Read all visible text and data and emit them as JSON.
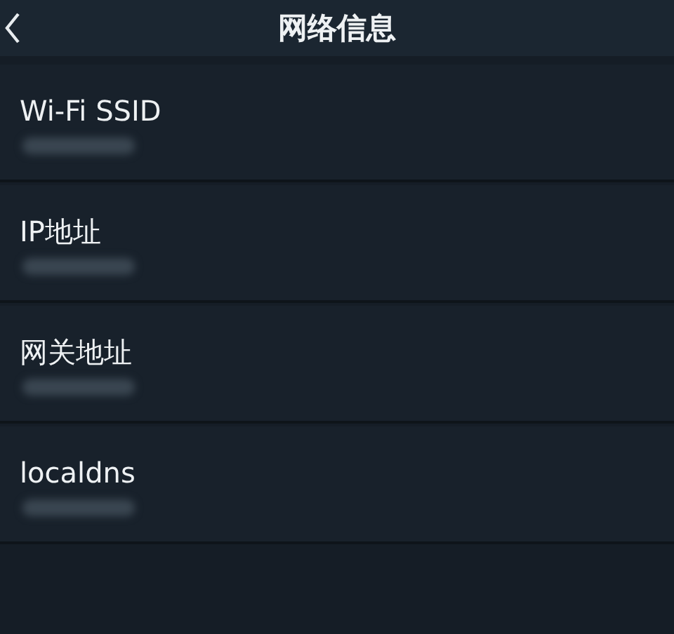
{
  "header": {
    "title": "网络信息"
  },
  "rows": [
    {
      "label": "Wi-Fi SSID",
      "value_redacted": true
    },
    {
      "label": "IP地址",
      "value_redacted": true
    },
    {
      "label": "网关地址",
      "value_redacted": true
    },
    {
      "label": "localdns",
      "value_redacted": true
    }
  ]
}
